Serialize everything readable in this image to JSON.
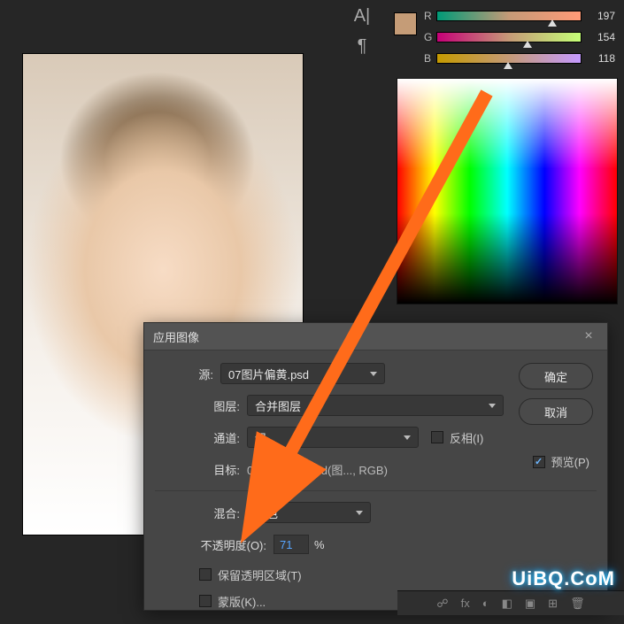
{
  "rgb": {
    "swatch_color": "#c59c77",
    "channels": [
      {
        "label": "R",
        "value": 197,
        "gradient": "linear-gradient(90deg,#009a77,#c59a77,#ff9a77)",
        "pos": 77
      },
      {
        "label": "G",
        "value": 154,
        "gradient": "linear-gradient(90deg,#c50077,#c59a77,#c5ff77)",
        "pos": 60
      },
      {
        "label": "B",
        "value": 118,
        "gradient": "linear-gradient(90deg,#c59a00,#c59a77,#c59aff)",
        "pos": 46
      }
    ]
  },
  "character_panel": {
    "item1": "A|",
    "item2": "¶"
  },
  "dialog": {
    "title": "应用图像",
    "labels": {
      "source": "源:",
      "layer": "图层:",
      "channel": "通道:",
      "target": "目标:",
      "blend": "混合:",
      "opacity": "不透明度(O):"
    },
    "source_file": "07图片偏黄.psd",
    "layer_value": "合并图层",
    "channel_value": "绿",
    "invert_label": "反相(I)",
    "target_value": "07图片偏黄.psd(图..., RGB)",
    "blend_value": "滤色",
    "opacity_value": "71",
    "percent": "%",
    "preserve_transparency": "保留透明区域(T)",
    "mask": "蒙版(K)...",
    "ok": "确定",
    "cancel": "取消",
    "preview": "预览(P)"
  },
  "layers_footer": {
    "icons": [
      "☍",
      "fx",
      "◐",
      "◧",
      "▣",
      "⊞",
      "🗑"
    ]
  },
  "watermark": "UiBQ.CoM"
}
